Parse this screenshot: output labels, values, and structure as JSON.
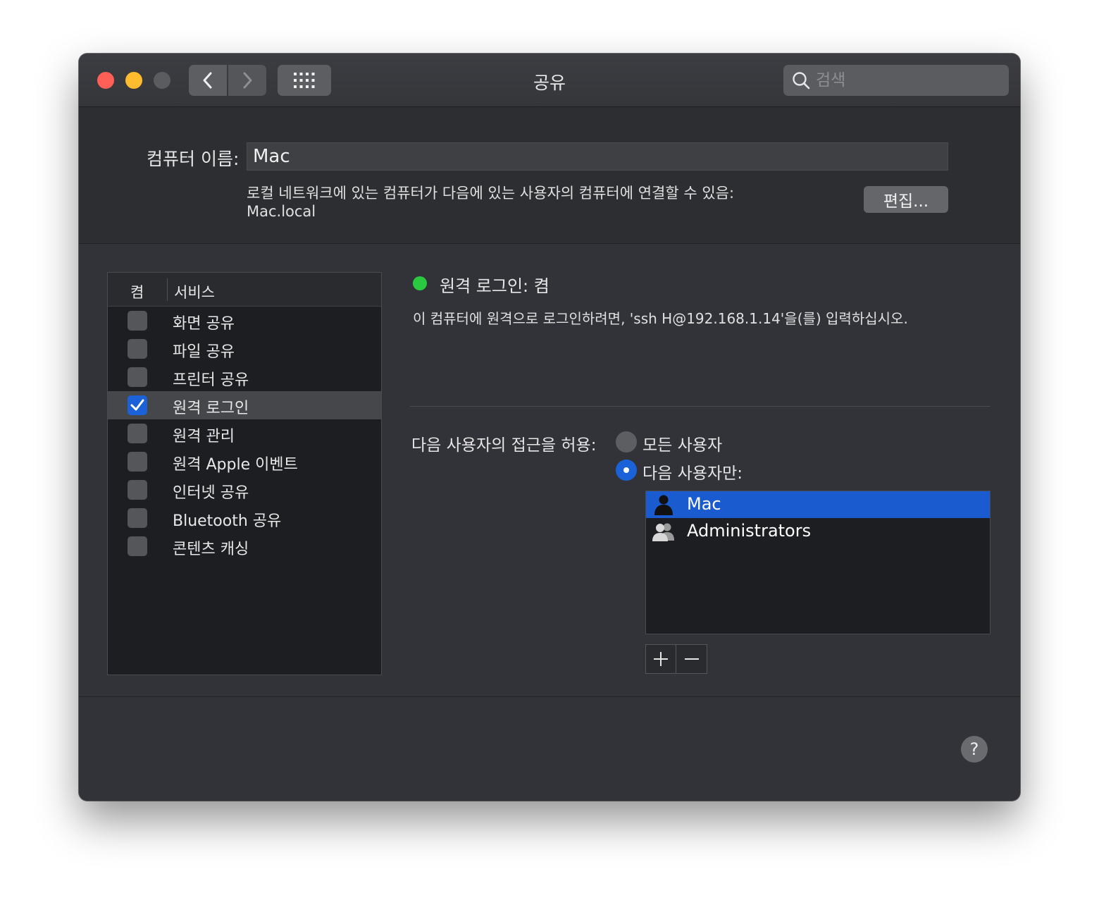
{
  "window": {
    "title": "공유",
    "search_placeholder": "검색"
  },
  "colors": {
    "accent": "#1b62d9",
    "status_on": "#29c940",
    "traffic_red": "#fe5f57",
    "traffic_yellow": "#febc2e"
  },
  "computer": {
    "name_label": "컴퓨터 이름:",
    "name_value": "Mac",
    "local_desc": "로컬 네트워크에 있는 컴퓨터가 다음에 있는 사용자의 컴퓨터에 연결할 수 있음:",
    "local_host": "Mac.local",
    "edit_label": "편집..."
  },
  "services": {
    "header_on": "켬",
    "header_service": "서비스",
    "items": [
      {
        "label": "화면 공유",
        "checked": false,
        "selected": false
      },
      {
        "label": "파일 공유",
        "checked": false,
        "selected": false
      },
      {
        "label": "프린터 공유",
        "checked": false,
        "selected": false
      },
      {
        "label": "원격 로그인",
        "checked": true,
        "selected": true
      },
      {
        "label": "원격 관리",
        "checked": false,
        "selected": false
      },
      {
        "label": "원격 Apple 이벤트",
        "checked": false,
        "selected": false
      },
      {
        "label": "인터넷 공유",
        "checked": false,
        "selected": false
      },
      {
        "label": "Bluetooth 공유",
        "checked": false,
        "selected": false
      },
      {
        "label": "콘텐츠 캐싱",
        "checked": false,
        "selected": false
      }
    ]
  },
  "detail": {
    "status_title": "원격 로그인: 켬",
    "status_desc": "이 컴퓨터에 원격으로 로그인하려면, 'ssh H@192.168.1.14'을(를) 입력하십시오.",
    "access_label": "다음 사용자의 접근을 허용:",
    "radio_all": "모든 사용자",
    "radio_only": "다음 사용자만:",
    "users": [
      {
        "name": "Mac",
        "icon": "user-icon",
        "selected": true
      },
      {
        "name": "Administrators",
        "icon": "group-icon",
        "selected": false
      }
    ],
    "add_label": "+",
    "remove_label": "−"
  },
  "help_label": "?"
}
